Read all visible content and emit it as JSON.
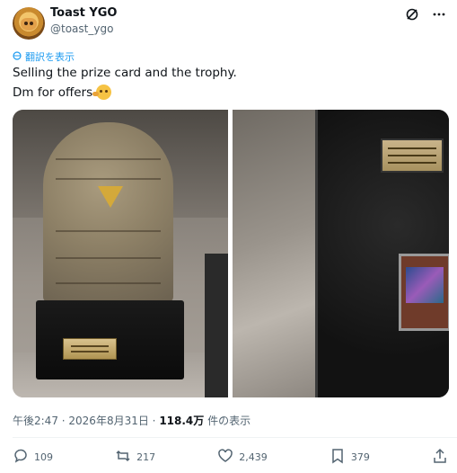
{
  "tweet": {
    "author_name": "Toast YGO",
    "author_handle": "@toast_ygo",
    "translate_label": "翻訳を表示",
    "text_line1": "Selling the prize card and the trophy.",
    "text_line2": "Dm for offers",
    "emoji": "face-emoji",
    "time": "午後2:47",
    "date": "2026年8月31日",
    "views": "118.4万",
    "views_label": "件の表示"
  },
  "actions": {
    "replies": "109",
    "reposts": "217",
    "likes": "2,439",
    "bookmarks": "379"
  },
  "colors": {
    "text": "#0f1419",
    "secondary": "#536471",
    "link": "#1d9bf0",
    "divider": "#eff3f4"
  },
  "icons": [
    "grok-icon",
    "more-icon",
    "translate-icon",
    "reply-icon",
    "repost-icon",
    "like-icon",
    "bookmark-icon",
    "share-icon"
  ]
}
